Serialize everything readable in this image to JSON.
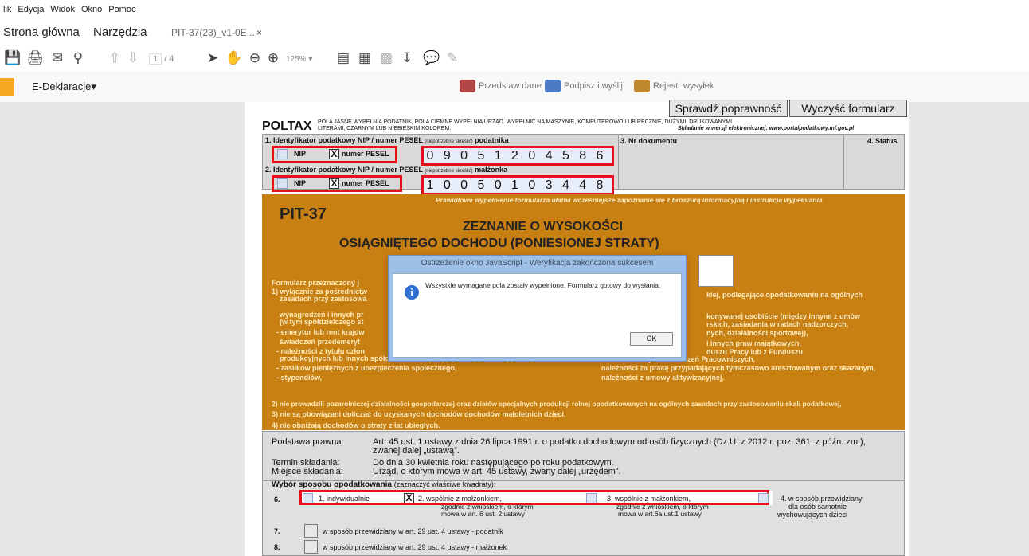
{
  "menu": [
    "lik",
    "Edycja",
    "Widok",
    "Okno",
    "Pomoc"
  ],
  "nav": {
    "home": "Strona główna",
    "tools": "Narzędzia",
    "doc_tab": "PIT-37(23)_v1-0E...",
    "close": "×"
  },
  "toolbar": {
    "page_current": "1",
    "page_total": "/ 4",
    "zoom": "125%"
  },
  "edekl": {
    "menu_label": "E-Deklaracje",
    "present": "Przedstaw dane",
    "sign_send": "Podpisz i wyślij",
    "register": "Rejestr wysyłek"
  },
  "form": {
    "check_btn": "Sprawdź poprawność",
    "clear_btn": "Wyczyść formularz",
    "poltax": "POLTAX",
    "header_note1": "POLA JASNE WYPEŁNIA PODATNIK, POLA CIEMNE WYPEŁNIA URZĄD. WYPEŁNIĆ NA MASZYNIE, KOMPUTEROWO LUB RĘCZNIE, DUŻYMI, DRUKOWANYMI",
    "header_note2": "LITERAMI, CZARNYM LUB NIEBIESKIM KOLOREM.",
    "header_right": "Składanie w wersji elektronicznej: www.portalpodatkowy.mf.gov.pl",
    "f1_label": "1. Identyfikator podatkowy NIP / numer PESEL",
    "f1_small": "(niepotrzebne skreślić)",
    "f1_suffix": "podatnika",
    "f2_label": "2. Identyfikator podatkowy NIP / numer PESEL",
    "f2_small": "(niepotrzebne skreślić)",
    "f2_suffix": "małżonka",
    "nip": "NIP",
    "pesel": "numer PESEL",
    "pesel1": [
      "0",
      "9",
      "0",
      "5",
      "1",
      "2",
      "0",
      "4",
      "5",
      "8",
      "6"
    ],
    "pesel2": [
      "1",
      "0",
      "0",
      "5",
      "0",
      "1",
      "0",
      "3",
      "4",
      "4",
      "8"
    ],
    "doc_no": "3. Nr dokumentu",
    "status": "4. Status",
    "notice": "Prawidłowe wypełnienie formularza ułatwi wcześniejsze zapoznanie się z broszurą informacyjną i instrukcją wypełniania",
    "pit": "PIT-37",
    "title1": "ZEZNANIE O WYSOKOŚCI",
    "title2": "OSIĄGNIĘTEGO DOCHODU (PONIESIONEJ STRATY)",
    "left_lines": [
      "Formularz przeznaczony j",
      "1) wyłącznie za pośrednictw",
      "zasadach przy zastosowa",
      "wynagrodzeń i innych pr",
      "(w tym spółdzielczego st",
      "- emerytur lub rent krajow",
      "świadczeń przedemeryt",
      "- należności z tytułu człon",
      "produkcyjnych lub innych spółdzielniach zajmujących się produkcją rolną,",
      "- zasiłków pieniężnych z ubezpieczenia społecznego,",
      "- stypendiów,"
    ],
    "right_lines": [
      "kiej, podlegające opodatkowaniu na ogólnych",
      "konywanej osobiście (między innymi z umów",
      "rskich, zasiadania w radach nadzorczych,",
      "nych, działalności sportowej),",
      "i innych praw majątkowych,",
      "duszu Pracy lub z Funduszu",
      "Gwarantowanych Świadczeń Pracowniczych,",
      "należności za pracę przypadających tymczasowo aresztowanym oraz skazanym,",
      "należności z umowy aktywizacyjnej,"
    ],
    "cond2": "2) nie prowadzili pozarolniczej działalności gospodarczej oraz działów specjalnych produkcji rolnej opodatkowanych na ogólnych zasadach przy zastosowaniu skali podatkowej,",
    "cond3": "3) nie są obowiązani doliczać do uzyskanych dochodów dochodów małoletnich dzieci,",
    "cond4": "4) nie obniżają dochodów o straty z lat ubiegłych.",
    "basis_label": "Podstawa prawna:",
    "basis_text1": "Art. 45 ust. 1 ustawy z dnia 26 lipca 1991 r. o podatku dochodowym od osób fizycznych (Dz.U. z 2012 r. poz. 361, z późn. zm.),",
    "basis_text2": "zwanej dalej „ustawą”.",
    "deadline_label": "Termin składania:",
    "deadline_text": "Do dnia 30 kwietnia roku następującego po roku podatkowym.",
    "place_label": "Miejsce składania:",
    "place_text": "Urząd, o którym mowa w art. 45 ustawy, zwany dalej „urzędem”.",
    "method_title": "Wybór sposobu opodatkowania",
    "method_note": "(zaznaczyć właściwe kwadraty):",
    "row6": "6.",
    "opt1": "1. indywidualnie",
    "opt2": "2. wspólnie z małżonkiem,",
    "opt2_sub1": "zgodnie z wnioskiem, o którym",
    "opt2_sub2": "mowa w art. 6 ust. 2 ustawy",
    "opt3": "3. wspólnie z małżonkiem,",
    "opt3_sub1": "zgodnie z wnioskiem, o którym",
    "opt3_sub2": "mowa w art.6a ust.1 ustawy",
    "opt4_1": "4. w sposób przewidziany",
    "opt4_2": "dla osób samotnie",
    "opt4_3": "wychowujących dzieci",
    "row7": "7.",
    "row7_text": "w sposób przewidziany w art. 29 ust. 4 ustawy - podatnik",
    "row8": "8.",
    "row8_text": "w sposób przewidziany w art. 29 ust. 4 ustawy - małżonek"
  },
  "dialog": {
    "title": "Ostrzeżenie okno JavaScript - Weryfikacja zakończona sukcesem",
    "message": "Wszystkie wymagane pola zostały wypełnione. Formularz gotowy do wysłania.",
    "ok": "OK"
  },
  "colors": {
    "accent": "#e8101c",
    "orange": "#c98012",
    "dialog_title": "#9ec0e6"
  }
}
